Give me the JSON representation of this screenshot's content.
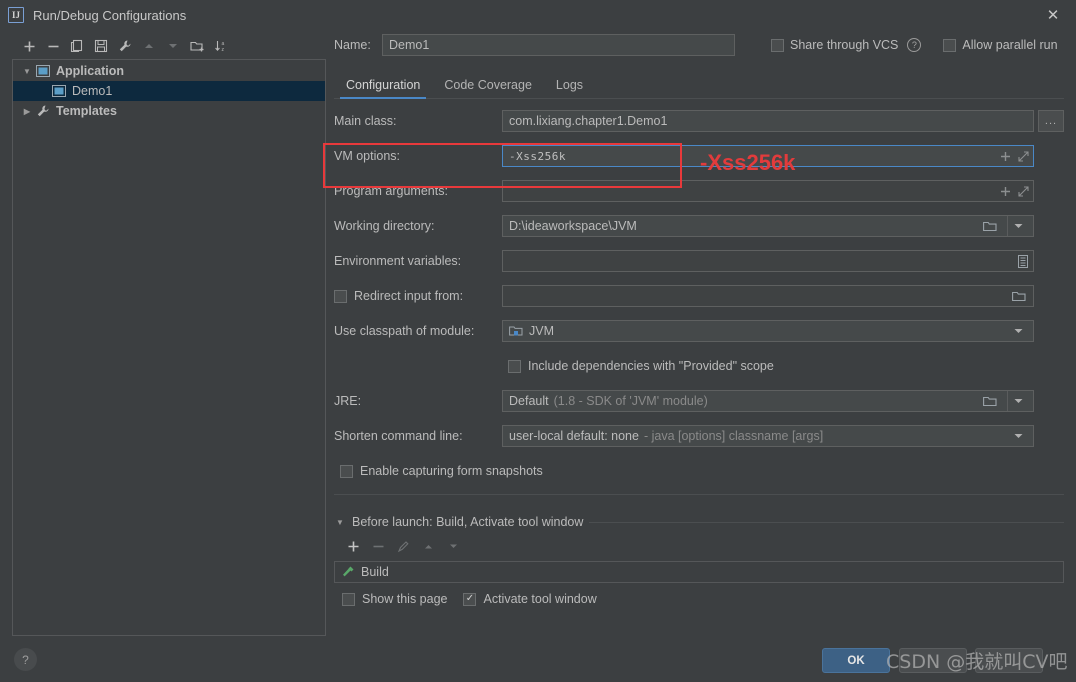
{
  "window": {
    "title": "Run/Debug Configurations",
    "app_icon": "IJ",
    "close_icon": "✕"
  },
  "sidebar": {
    "toolbar": [
      {
        "name": "add-button",
        "icon": "plus-icon",
        "label": "+"
      },
      {
        "name": "remove-button",
        "icon": "minus-icon",
        "label": "−"
      },
      {
        "name": "copy-button",
        "icon": "copy-icon",
        "label": "Copy"
      },
      {
        "name": "save-button",
        "icon": "save-icon",
        "label": "Save"
      },
      {
        "name": "edit-templates-button",
        "icon": "wrench-icon",
        "label": "Edit Templates"
      },
      {
        "name": "move-up-button",
        "icon": "arrow-up-icon",
        "label": "Move Up"
      },
      {
        "name": "move-down-button",
        "icon": "arrow-down-icon",
        "label": "Move Down"
      },
      {
        "name": "new-folder-button",
        "icon": "folder-add-icon",
        "label": "New Folder"
      },
      {
        "name": "sort-button",
        "icon": "sort-az-icon",
        "label": "Sort Configurations"
      }
    ],
    "tree": [
      {
        "label": "Application",
        "icon": "application-icon",
        "expanded": true,
        "level": 0,
        "selected": false,
        "twisty": "▼"
      },
      {
        "label": "Demo1",
        "icon": "application-icon",
        "expanded": false,
        "level": 1,
        "selected": true,
        "twisty": ""
      },
      {
        "label": "Templates",
        "icon": "wrench-icon",
        "expanded": false,
        "level": 0,
        "selected": false,
        "twisty": "▶"
      }
    ]
  },
  "header": {
    "name_label": "Name:",
    "name_value": "Demo1",
    "name_placeholder": "",
    "share_vcs_label": "Share through VCS",
    "share_vcs_checked": false,
    "share_vcs_help_icon": "?",
    "allow_parallel_label": "Allow parallel run",
    "allow_parallel_checked": false
  },
  "tabs": [
    {
      "label": "Configuration",
      "active": true
    },
    {
      "label": "Code Coverage",
      "active": false
    },
    {
      "label": "Logs",
      "active": false
    }
  ],
  "form": {
    "main_class": {
      "label": "Main class:",
      "value": "com.lixiang.chapter1.Demo1",
      "browse_label": "..."
    },
    "vm_options": {
      "label": "VM options:",
      "value": "-Xss256k",
      "expand_icon": "expand-icon",
      "insert_icon": "plus-icon",
      "focused": true
    },
    "program_arguments": {
      "label": "Program arguments:",
      "value": "",
      "expand_icon": "expand-icon",
      "insert_icon": "plus-icon"
    },
    "working_directory": {
      "label": "Working directory:",
      "value": "D:\\ideaworkspace\\JVM",
      "browse_icon": "folder-icon",
      "dropdown_icon": "chevron-down-icon"
    },
    "environment_variables": {
      "label": "Environment variables:",
      "value": "",
      "browse_icon": "list-icon"
    },
    "redirect_input": {
      "label": "Redirect input from:",
      "checked": false,
      "value": "",
      "browse_icon": "folder-icon"
    },
    "classpath_module": {
      "label": "Use classpath of module:",
      "value": "JVM",
      "module_icon": "module-icon",
      "dropdown_icon": "chevron-down-icon"
    },
    "include_provided": {
      "label": "Include dependencies with \"Provided\" scope",
      "checked": false
    },
    "jre": {
      "label": "JRE:",
      "value": "Default",
      "value_hint": "(1.8 - SDK of 'JVM' module)",
      "browse_icon": "folder-icon",
      "dropdown_icon": "chevron-down-icon"
    },
    "shorten_command_line": {
      "label": "Shorten command line:",
      "value": "user-local default: none",
      "value_hint": "- java [options] classname [args]",
      "dropdown_icon": "chevron-down-icon"
    },
    "form_snapshots": {
      "label": "Enable capturing form snapshots",
      "checked": false
    }
  },
  "before_launch": {
    "title": "Before launch: Build, Activate tool window",
    "twisty": "▼",
    "toolbar": [
      {
        "name": "add-task-button",
        "icon": "plus-icon",
        "enabled": true
      },
      {
        "name": "remove-task-button",
        "icon": "minus-icon",
        "enabled": false
      },
      {
        "name": "edit-task-button",
        "icon": "pencil-icon",
        "enabled": false
      },
      {
        "name": "task-up-button",
        "icon": "arrow-up-icon",
        "enabled": false
      },
      {
        "name": "task-down-button",
        "icon": "arrow-down-icon",
        "enabled": false
      }
    ],
    "tasks": [
      {
        "label": "Build",
        "icon": "build-hammer-icon"
      }
    ],
    "show_page": {
      "label": "Show this page",
      "checked": false
    },
    "activate_tool_window": {
      "label": "Activate tool window",
      "checked": true
    }
  },
  "footer": {
    "help_label": "?",
    "ok_label": "OK"
  },
  "annotation": {
    "text": "-Xss256k",
    "color": "#e23b3c",
    "box_color": "#e8393b"
  },
  "watermark": {
    "text": "CSDN @我就叫CV吧"
  },
  "colors": {
    "window_bg": "#3c3f41",
    "field_bg": "#45494a",
    "selection": "#0d293e",
    "accent": "#4a88c7",
    "ok_button": "#3d6185",
    "build_green": "#59a869"
  }
}
